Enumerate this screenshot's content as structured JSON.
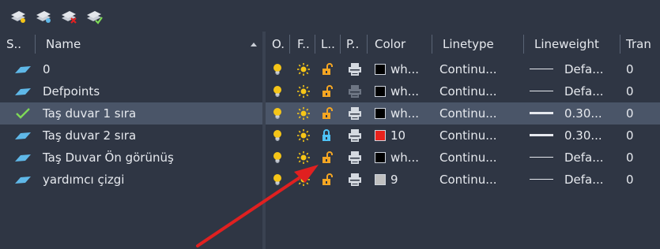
{
  "toolbar": {
    "tools": [
      {
        "icon": "new-layer-icon"
      },
      {
        "icon": "new-layer-frozen-icon"
      },
      {
        "icon": "delete-layer-icon"
      },
      {
        "icon": "set-current-layer-icon"
      }
    ]
  },
  "left_header": {
    "status": "S..",
    "name": "Name"
  },
  "right_header": {
    "on": "O.",
    "freeze": "F..",
    "lock": "L..",
    "plot": "P..",
    "color": "Color",
    "linetype": "Linetype",
    "lineweight": "Lineweight",
    "transparency": "Tran"
  },
  "layers": [
    {
      "name": "0",
      "current": false,
      "lock_state": "unlocked",
      "plot_state": "plot",
      "color_name": "wh...",
      "color_hex": "#000000",
      "linetype": "Continu...",
      "lineweight": "Defa...",
      "lw_thick": false,
      "transparency": "0",
      "selected": false
    },
    {
      "name": "Defpoints",
      "current": false,
      "lock_state": "unlocked",
      "plot_state": "noplot",
      "color_name": "wh...",
      "color_hex": "#000000",
      "linetype": "Continu...",
      "lineweight": "Defa...",
      "lw_thick": false,
      "transparency": "0",
      "selected": false
    },
    {
      "name": "Taş duvar 1 sıra",
      "current": true,
      "lock_state": "unlocked",
      "plot_state": "plot",
      "color_name": "wh...",
      "color_hex": "#000000",
      "linetype": "Continu...",
      "lineweight": "0.30...",
      "lw_thick": true,
      "transparency": "0",
      "selected": true
    },
    {
      "name": "Taş duvar 2 sıra",
      "current": false,
      "lock_state": "locked",
      "plot_state": "plot",
      "color_name": "10",
      "color_hex": "#e8221c",
      "linetype": "Continu...",
      "lineweight": "0.30...",
      "lw_thick": true,
      "transparency": "0",
      "selected": false
    },
    {
      "name": "Taş Duvar Ön görünüş",
      "current": false,
      "lock_state": "unlocked",
      "plot_state": "plot",
      "color_name": "wh...",
      "color_hex": "#000000",
      "linetype": "Continu...",
      "lineweight": "Defa...",
      "lw_thick": false,
      "transparency": "0",
      "selected": false
    },
    {
      "name": "yardımcı çizgi",
      "current": false,
      "lock_state": "unlocked",
      "plot_state": "plot",
      "color_name": "9",
      "color_hex": "#c0c0c0",
      "linetype": "Continu...",
      "lineweight": "Defa...",
      "lw_thick": false,
      "transparency": "0",
      "selected": false
    }
  ],
  "colors": {
    "accent_selected": "#4a5568",
    "bulb": "#f5c518",
    "sun": "#f5c518",
    "lock_unlocked": "#f5a623",
    "lock_locked": "#4fc3f7",
    "current_check": "#7ed957",
    "arrow": "#e02020"
  }
}
